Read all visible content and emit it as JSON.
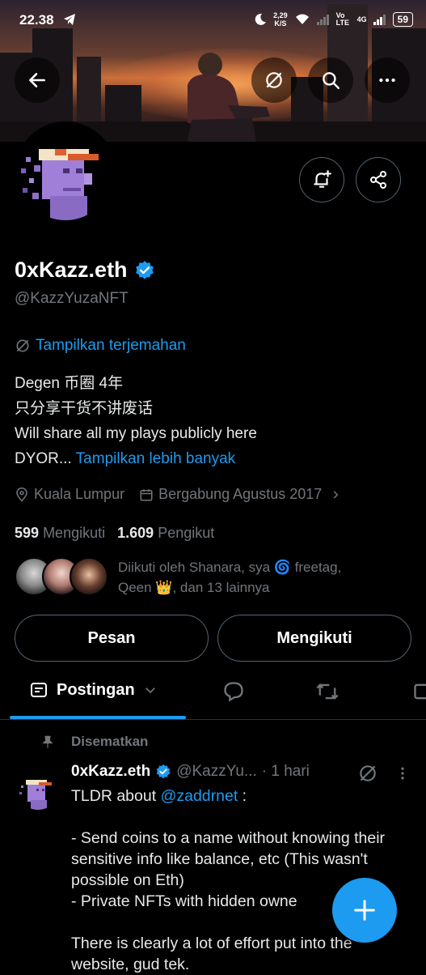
{
  "status_bar": {
    "time": "22.38",
    "speed": "2,29",
    "speed_unit": "K/S",
    "network": "4G",
    "volte": "Vo LTE",
    "battery": "59"
  },
  "profile": {
    "display_name": "0xKazz.eth",
    "handle": "@KazzYuzaNFT",
    "translate_label": "Tampilkan terjemahan",
    "bio_lines": [
      "Degen 币圈 4年",
      "只分享干货不讲废话",
      "Will share all my plays publicly here"
    ],
    "bio_last": "DYOR...",
    "show_more": "Tampilkan lebih banyak",
    "location": "Kuala Lumpur",
    "joined": "Bergabung Agustus 2017",
    "following_count": "599",
    "following_label": "Mengikuti",
    "followers_count": "1.609",
    "followers_label": "Pengikut",
    "followed_by_line1": "Diikuti oleh Shanara, sya 🌀 freetag,",
    "followed_by_line2": "Qeen 👑, dan 13 lainnya"
  },
  "buttons": {
    "message": "Pesan",
    "following": "Mengikuti"
  },
  "tabs": {
    "active": "Postingan"
  },
  "post": {
    "pinned_label": "Disematkan",
    "author": "0xKazz.eth",
    "handle": "@KazzYu...",
    "time": "· 1 hari",
    "line1_pre": "TLDR about ",
    "mention": "@zaddrnet",
    "line1_post": " :",
    "line2": "- Send coins to a name without knowing their sensitive info like balance, etc (This wasn't possible on Eth)",
    "line3": "- Private NFTs with hidden owne",
    "line4": "There is clearly a lot of effort put into the website, gud tek."
  },
  "colors": {
    "accent": "#1d9bf0",
    "background": "#000000",
    "muted": "#71767b"
  }
}
